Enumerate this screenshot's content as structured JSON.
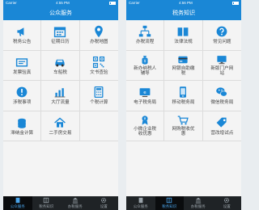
{
  "colors": {
    "accent": "#1a87d6",
    "tabbar": "#1f2326",
    "tab_active": "#4aa3e8"
  },
  "left": {
    "carrier": "Carrier",
    "time": "4:55 PM",
    "title": "公众服务",
    "items": [
      {
        "label": "税务公告",
        "icon": "megaphone-icon"
      },
      {
        "label": "征期日历",
        "icon": "calendar-icon"
      },
      {
        "label": "办税地图",
        "icon": "map-pin-icon"
      },
      {
        "label": "发票验真",
        "icon": "invoice-icon"
      },
      {
        "label": "车船税",
        "icon": "car-icon"
      },
      {
        "label": "文书查验",
        "icon": "qr-code-icon"
      },
      {
        "label": "涉税事项",
        "icon": "alert-icon"
      },
      {
        "label": "大厅流量",
        "icon": "chart-icon"
      },
      {
        "label": "个税计算",
        "icon": "calculator-icon"
      },
      {
        "label": "滞纳金计算",
        "icon": "coins-icon"
      },
      {
        "label": "二手房交易",
        "icon": "house-icon"
      }
    ],
    "tabs": [
      {
        "label": "公众服务",
        "icon": "building-icon",
        "active": true
      },
      {
        "label": "税务知识",
        "icon": "book-icon",
        "active": false
      },
      {
        "label": "办税服务",
        "icon": "bank-icon",
        "active": false
      },
      {
        "label": "设置",
        "icon": "gear-icon",
        "active": false
      }
    ]
  },
  "right": {
    "carrier": "Carrier",
    "time": "4:56 PM",
    "title": "税务知识",
    "items": [
      {
        "label": "办税流程",
        "icon": "flow-icon"
      },
      {
        "label": "法律法规",
        "icon": "law-book-icon"
      },
      {
        "label": "常见问题",
        "icon": "question-icon"
      },
      {
        "label": "新办纳税人\n辅导",
        "icon": "money-bag-icon"
      },
      {
        "label": "网银自助缴\n税",
        "icon": "bank-card-icon"
      },
      {
        "label": "新版门户网\n站",
        "icon": "monitor-icon"
      },
      {
        "label": "电子税务局",
        "icon": "e-tax-icon"
      },
      {
        "label": "移动税务局",
        "icon": "mobile-icon"
      },
      {
        "label": "微信税务局",
        "icon": "wechat-icon"
      },
      {
        "label": "小微企业税\n收优惠",
        "icon": "enterprise-icon"
      },
      {
        "label": "网购税收优\n惠",
        "icon": "shopping-cart-icon"
      },
      {
        "label": "营改增试点",
        "icon": "tag-icon"
      }
    ],
    "tabs": [
      {
        "label": "公众服务",
        "icon": "building-icon",
        "active": false
      },
      {
        "label": "税务知识",
        "icon": "book-icon",
        "active": true
      },
      {
        "label": "办税服务",
        "icon": "bank-icon",
        "active": false
      },
      {
        "label": "设置",
        "icon": "gear-icon",
        "active": false
      }
    ]
  }
}
